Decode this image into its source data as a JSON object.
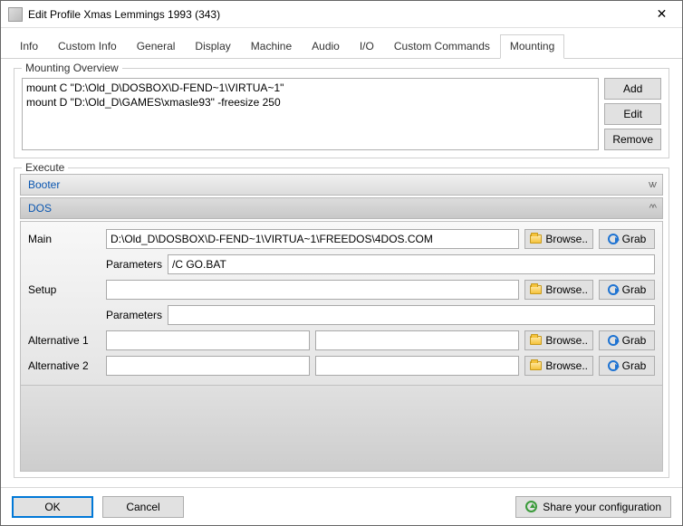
{
  "window": {
    "title": "Edit Profile Xmas Lemmings 1993 (343)"
  },
  "tabs": [
    "Info",
    "Custom Info",
    "General",
    "Display",
    "Machine",
    "Audio",
    "I/O",
    "Custom Commands",
    "Mounting"
  ],
  "active_tab": "Mounting",
  "mounting_overview": {
    "label": "Mounting Overview",
    "text": "mount C \"D:\\Old_D\\DOSBOX\\D-FEND~1\\VIRTUA~1\"\nmount D \"D:\\Old_D\\GAMES\\xmasle93\" -freesize 250",
    "buttons": {
      "add": "Add",
      "edit": "Edit",
      "remove": "Remove"
    }
  },
  "execute": {
    "label": "Execute",
    "booter": {
      "label": "Booter"
    },
    "dos": {
      "label": "DOS",
      "main_label": "Main",
      "main_value": "D:\\Old_D\\DOSBOX\\D-FEND~1\\VIRTUA~1\\FREEDOS\\4DOS.COM",
      "main_params_label": "Parameters",
      "main_params_value": "/C GO.BAT",
      "setup_label": "Setup",
      "setup_value": "",
      "setup_params_label": "Parameters",
      "setup_params_value": "",
      "alt1_label": "Alternative 1",
      "alt1_a": "",
      "alt1_b": "",
      "alt2_label": "Alternative 2",
      "alt2_a": "",
      "alt2_b": "",
      "browse": "Browse..",
      "grab": "Grab"
    }
  },
  "footer": {
    "ok": "OK",
    "cancel": "Cancel",
    "share": "Share your configuration"
  }
}
